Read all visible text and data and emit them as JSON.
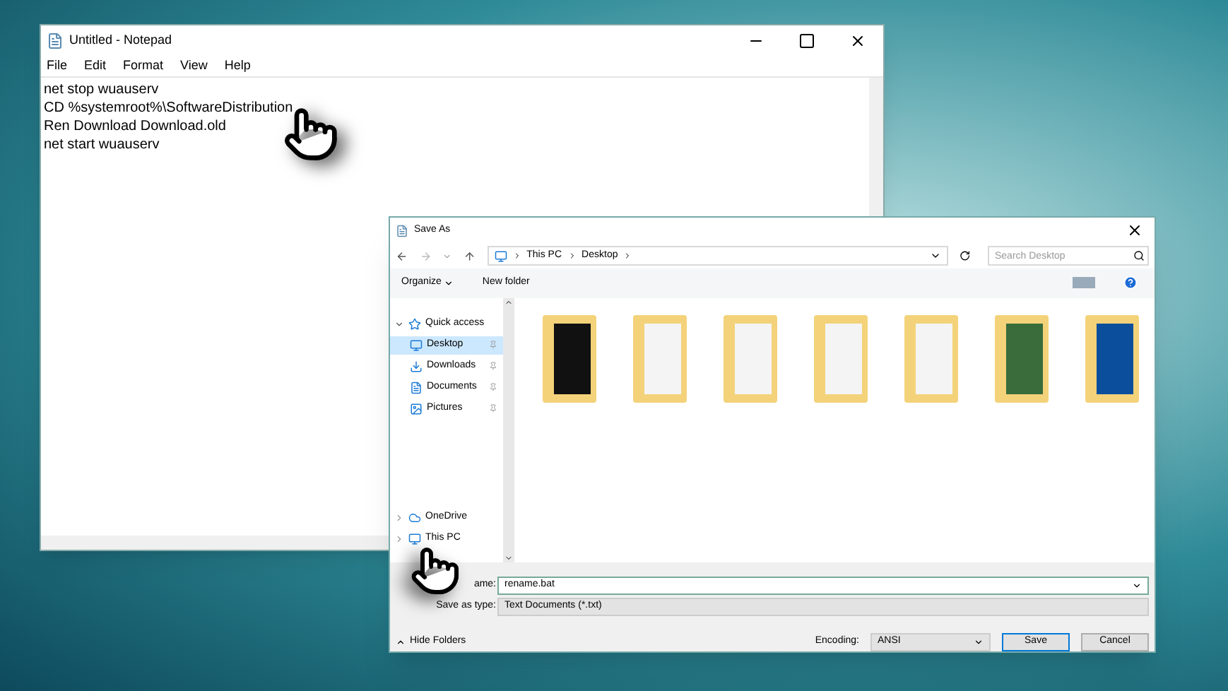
{
  "notepad": {
    "title": "Untitled - Notepad",
    "menu": [
      "File",
      "Edit",
      "Format",
      "View",
      "Help"
    ],
    "lines": [
      "net stop wuauserv",
      "CD %systemroot%\\SoftwareDistribution",
      "Ren Download Download.old",
      "net start wuauserv"
    ]
  },
  "save_as": {
    "title": "Save As",
    "breadcrumb": [
      "This PC",
      "Desktop"
    ],
    "search": {
      "placeholder": "Search Desktop"
    },
    "toolbar": [
      "Organize",
      "New folder"
    ],
    "nav": [
      {
        "label": "Quick access",
        "kind": "group",
        "expanded": true,
        "selected": false
      },
      {
        "label": "Desktop",
        "kind": "item",
        "selected": true
      },
      {
        "label": "Downloads",
        "kind": "item",
        "selected": false
      },
      {
        "label": "Documents",
        "kind": "item",
        "selected": false
      },
      {
        "label": "Pictures",
        "kind": "item",
        "selected": false
      },
      {
        "label": "OneDrive",
        "kind": "group",
        "expanded": false,
        "selected": false
      },
      {
        "label": "This PC",
        "kind": "group",
        "expanded": false,
        "selected": false
      }
    ],
    "folders": [
      {
        "kind": "dark"
      },
      {
        "kind": "docs"
      },
      {
        "kind": "docs"
      },
      {
        "kind": "docs"
      },
      {
        "kind": "docs"
      },
      {
        "kind": "green"
      },
      {
        "kind": "blue"
      }
    ],
    "file_name": {
      "label": "ame:",
      "value": "rename.bat"
    },
    "save_type": {
      "label": "Save as type:",
      "value": "Text Documents (*.txt)"
    },
    "hide_folders": "Hide Folders",
    "encoding": {
      "label": "Encoding:",
      "value": "ANSI"
    },
    "buttons": [
      "Save",
      "Cancel"
    ]
  }
}
